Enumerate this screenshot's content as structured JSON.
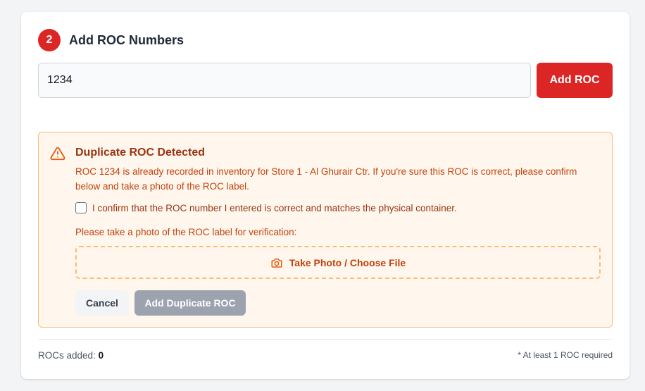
{
  "step": {
    "number": "2",
    "title": "Add ROC Numbers"
  },
  "roc_input": {
    "value": "1234"
  },
  "add_roc_button": "Add ROC",
  "warning": {
    "title": "Duplicate ROC Detected",
    "message": "ROC 1234 is already recorded in inventory for Store 1 - Al Ghurair Ctr. If you're sure this ROC is correct, please confirm below and take a photo of the ROC label.",
    "confirm_label": "I confirm that the ROC number I entered is correct and matches the physical container.",
    "confirm_checked": false,
    "photo_prompt": "Please take a photo of the ROC label for verification:",
    "photo_button": "Take Photo / Choose File",
    "cancel_button": "Cancel",
    "add_duplicate_button": "Add Duplicate ROC"
  },
  "footer": {
    "rocs_added_label": "ROCs added:",
    "rocs_added_count": "0",
    "requirement_note": "* At least 1 ROC required"
  },
  "icons": {
    "warning": "warning-triangle-icon",
    "camera": "camera-icon"
  },
  "colors": {
    "accent": "#dc2626",
    "warning_bg": "#fff7ed",
    "warning_border": "#fdba74",
    "warning_text": "#c2410c",
    "disabled_button": "#9ca3af"
  }
}
